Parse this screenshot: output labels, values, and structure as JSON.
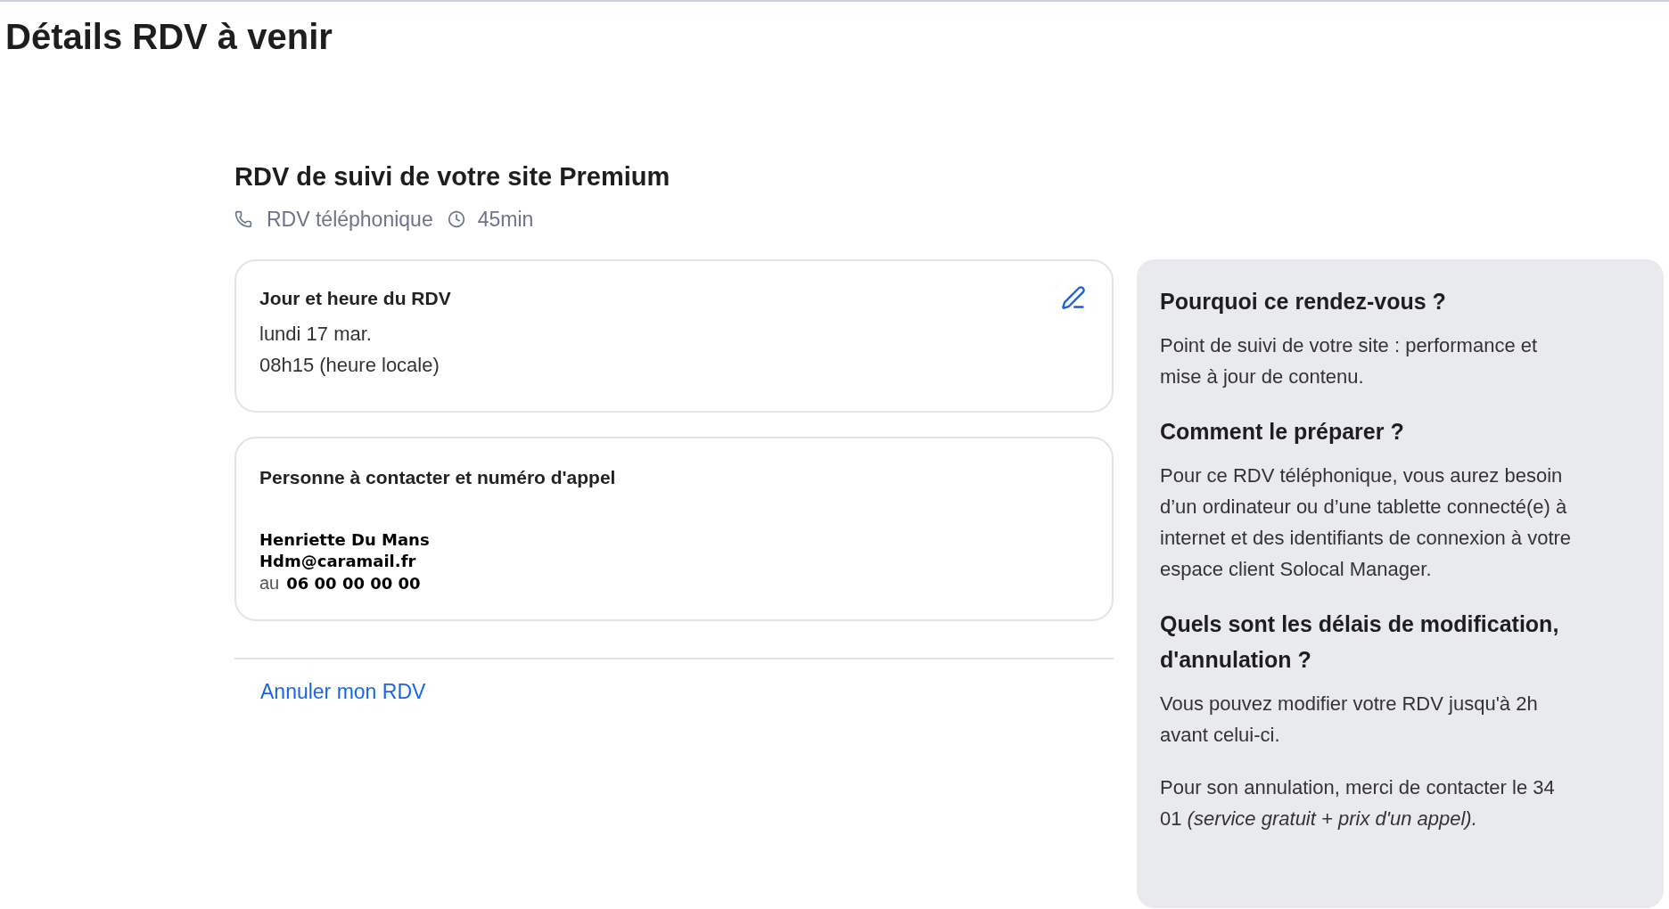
{
  "page_title": "Détails RDV à venir",
  "appointment": {
    "title": "RDV de suivi de votre site Premium",
    "type": "RDV téléphonique",
    "duration": "45min"
  },
  "date_card": {
    "heading": "Jour et heure du RDV",
    "date": "lundi 17 mar.",
    "time": "08h15 (heure locale)"
  },
  "contact_card": {
    "heading": "Personne à contacter et numéro d'appel",
    "name": "Henriette Du Mans",
    "email": "Hdm@caramail.fr",
    "phone_prefix": "au",
    "phone": "06 00 00 00 00"
  },
  "cancel_link": "Annuler mon RDV",
  "info_panel": {
    "sections": [
      {
        "heading": "Pourquoi ce rendez-vous ?",
        "paragraphs": [
          "Point de suivi de votre site : performance et mise à jour de contenu."
        ]
      },
      {
        "heading": "Comment le préparer ?",
        "paragraphs": [
          "Pour ce RDV téléphonique, vous aurez besoin d’un ordinateur ou d’une tablette connecté(e) à internet et des identifiants de connexion à votre espace client Solocal Manager."
        ]
      },
      {
        "heading": "Quels sont les délais de modification, d'annulation ?",
        "paragraphs": [
          "Vous pouvez modifier votre RDV jusqu'à 2h avant celui-ci.",
          "Pour son annulation, merci de contacter le 34 01 *(service gratuit + prix d'un appel).*"
        ]
      }
    ]
  }
}
